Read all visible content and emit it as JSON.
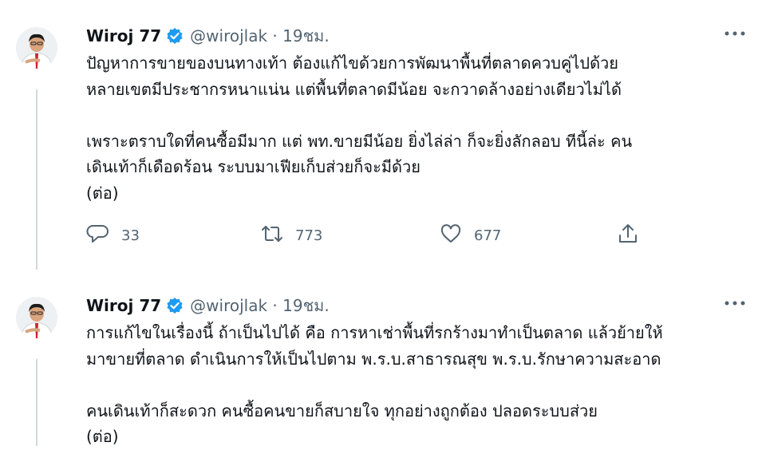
{
  "tweets": [
    {
      "author_name": "Wiroj 77",
      "handle_time": "@wirojlak · 19ชม.",
      "lines": [
        "ปัญหาการขายของบนทางเท้า ต้องแก้ไขด้วยการพัฒนาพื้นที่ตลาดควบคู่ไปด้วย",
        "หลายเขตมีประชากรหนาแน่น แต่พื้นที่ตลาดมีน้อย จะกวาดล้างอย่างเดียวไม่ได้",
        "",
        "เพราะตราบใดที่คนซื้อมีมาก แต่ พท.ขายมีน้อย ยิ่งไล่ล่า ก็จะยิ่งลักลอบ ทีนี้ล่ะ คน",
        "เดินเท้าก็เดือดร้อน ระบบมาเฟียเก็บส่วยก็จะมีด้วย",
        "(ต่อ)"
      ],
      "replies": "33",
      "retweets": "773",
      "likes": "677"
    },
    {
      "author_name": "Wiroj 77",
      "handle_time": "@wirojlak · 19ชม.",
      "lines": [
        "การแก้ไขในเรื่องนี้ ถ้าเป็นไปได้ คือ การหาเช่าพื้นที่รกร้างมาทำเป็นตลาด แล้วย้ายให้",
        "มาขายที่ตลาด ดำเนินการให้เป็นไปตาม พ.ร.บ.สาธารณสุข พ.ร.บ.รักษาความสะอาด",
        "",
        "คนเดินเท้าก็สะดวก คนซื้อคนขายก็สบายใจ ทุกอย่างถูกต้อง ปลอดระบบส่วย",
        "(ต่อ)"
      ]
    }
  ],
  "icons": {
    "verified": "verified-badge-icon",
    "more": "more-options-icon",
    "reply": "reply-icon",
    "retweet": "retweet-icon",
    "like": "heart-icon",
    "share": "share-icon"
  },
  "colors": {
    "text": "#0f1419",
    "secondary": "#536471",
    "verified": "#1d9bf0",
    "thread_line": "#cfd9de"
  }
}
